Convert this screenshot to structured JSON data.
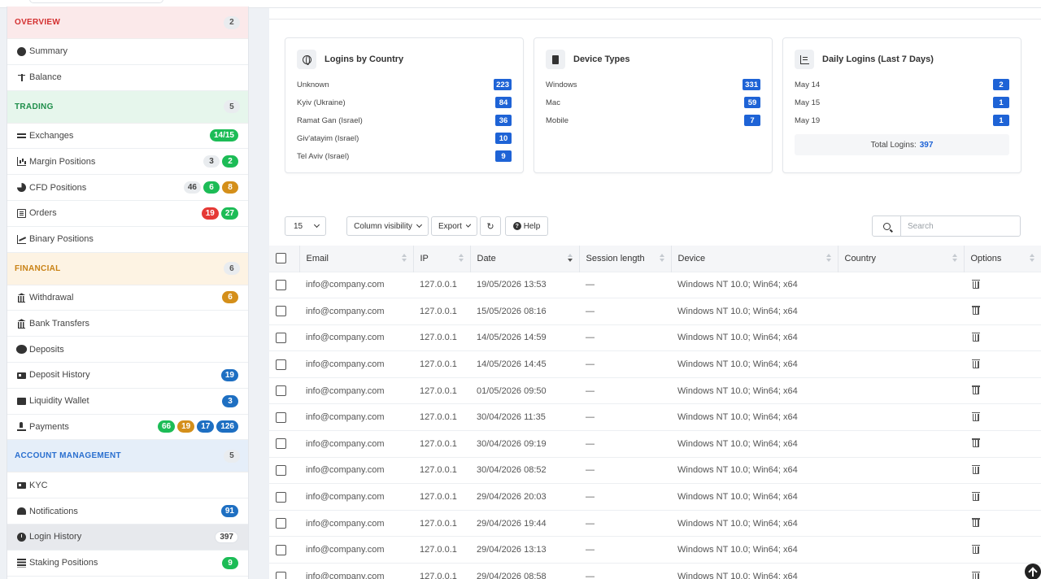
{
  "sidebar": {
    "sections": [
      {
        "key": "overview",
        "label": "OVERVIEW",
        "count": "2",
        "items": [
          {
            "key": "summary",
            "label": "Summary",
            "icon": "user-circle-icon",
            "badges": []
          },
          {
            "key": "balance",
            "label": "Balance",
            "icon": "scale-icon",
            "badges": []
          }
        ]
      },
      {
        "key": "trading",
        "label": "TRADING",
        "count": "5",
        "items": [
          {
            "key": "exchanges",
            "label": "Exchanges",
            "icon": "exchange-arrows-icon",
            "badges": [
              {
                "text": "14/15",
                "color": "green"
              }
            ]
          },
          {
            "key": "margin-positions",
            "label": "Margin Positions",
            "icon": "bar-chart-icon",
            "badges": [
              {
                "text": "3",
                "color": "grey"
              },
              {
                "text": "2",
                "color": "green"
              }
            ]
          },
          {
            "key": "cfd-positions",
            "label": "CFD Positions",
            "icon": "pie-chart-icon",
            "badges": [
              {
                "text": "46",
                "color": "grey"
              },
              {
                "text": "6",
                "color": "green"
              },
              {
                "text": "8",
                "color": "orange"
              }
            ]
          },
          {
            "key": "orders",
            "label": "Orders",
            "icon": "list-icon",
            "badges": [
              {
                "text": "19",
                "color": "red"
              },
              {
                "text": "27",
                "color": "green"
              }
            ]
          },
          {
            "key": "binary-positions",
            "label": "Binary Positions",
            "icon": "line-chart-icon",
            "badges": []
          }
        ]
      },
      {
        "key": "financial",
        "label": "FINANCIAL",
        "count": "6",
        "items": [
          {
            "key": "withdrawal",
            "label": "Withdrawal",
            "icon": "bank-icon",
            "badges": [
              {
                "text": "6",
                "color": "orange"
              }
            ]
          },
          {
            "key": "bank-transfers",
            "label": "Bank Transfers",
            "icon": "bank-icon",
            "badges": []
          },
          {
            "key": "deposits",
            "label": "Deposits",
            "icon": "piggy-bank-icon",
            "badges": []
          },
          {
            "key": "deposit-history",
            "label": "Deposit History",
            "icon": "credit-card-icon",
            "badges": [
              {
                "text": "19",
                "color": "blue"
              }
            ]
          },
          {
            "key": "liquidity-wallet",
            "label": "Liquidity Wallet",
            "icon": "wallet-icon",
            "badges": [
              {
                "text": "3",
                "color": "blue"
              }
            ]
          },
          {
            "key": "payments",
            "label": "Payments",
            "icon": "hand-coin-icon",
            "badges": [
              {
                "text": "66",
                "color": "green"
              },
              {
                "text": "19",
                "color": "orange"
              },
              {
                "text": "17",
                "color": "blue"
              },
              {
                "text": "126",
                "color": "blue"
              }
            ]
          }
        ]
      },
      {
        "key": "account",
        "label": "ACCOUNT MANAGEMENT",
        "count": "5",
        "items": [
          {
            "key": "kyc",
            "label": "KYC",
            "icon": "id-card-icon",
            "badges": []
          },
          {
            "key": "notifications",
            "label": "Notifications",
            "icon": "bell-icon",
            "badges": [
              {
                "text": "91",
                "color": "blue"
              }
            ]
          },
          {
            "key": "login-history",
            "label": "Login History",
            "icon": "clock-icon",
            "active": true,
            "badges": [
              {
                "text": "397",
                "color": "white"
              }
            ]
          },
          {
            "key": "staking-positions",
            "label": "Staking Positions",
            "icon": "layers-icon",
            "badges": [
              {
                "text": "9",
                "color": "green"
              }
            ]
          }
        ]
      }
    ]
  },
  "cards": {
    "country": {
      "title": "Logins by Country",
      "icon": "globe-icon",
      "rows": [
        {
          "label": "Unknown",
          "value": "223"
        },
        {
          "label": "Kyiv (Ukraine)",
          "value": "84"
        },
        {
          "label": "Ramat Gan (Israel)",
          "value": "36"
        },
        {
          "label": "Giv'atayim (Israel)",
          "value": "10"
        },
        {
          "label": "Tel Aviv (Israel)",
          "value": "9"
        }
      ]
    },
    "device": {
      "title": "Device Types",
      "icon": "mobile-icon",
      "rows": [
        {
          "label": "Windows",
          "value": "331"
        },
        {
          "label": "Mac",
          "value": "59"
        },
        {
          "label": "Mobile",
          "value": "7"
        }
      ]
    },
    "daily": {
      "title": "Daily Logins (Last 7 Days)",
      "icon": "bar-chart-icon",
      "rows": [
        {
          "label": "May 14",
          "value": "2"
        },
        {
          "label": "May 15",
          "value": "1"
        },
        {
          "label": "May 19",
          "value": "1"
        }
      ],
      "total_label": "Total Logins:",
      "total_value": "397"
    }
  },
  "toolbar": {
    "page_size": "15",
    "column_visibility": "Column visibility",
    "export": "Export",
    "help": "Help",
    "search_placeholder": "Search"
  },
  "table": {
    "columns": [
      "Email",
      "IP",
      "Date",
      "Session length",
      "Device",
      "Country",
      "Options"
    ],
    "rows": [
      {
        "email": "info@company.com",
        "ip": "127.0.0.1",
        "date": "19/05/2026 13:53",
        "session": "—",
        "device": "Windows NT 10.0; Win64; x64",
        "country": ""
      },
      {
        "email": "info@company.com",
        "ip": "127.0.0.1",
        "date": "15/05/2026 08:16",
        "session": "—",
        "device": "Windows NT 10.0; Win64; x64",
        "country": ""
      },
      {
        "email": "info@company.com",
        "ip": "127.0.0.1",
        "date": "14/05/2026 14:59",
        "session": "—",
        "device": "Windows NT 10.0; Win64; x64",
        "country": ""
      },
      {
        "email": "info@company.com",
        "ip": "127.0.0.1",
        "date": "14/05/2026 14:45",
        "session": "—",
        "device": "Windows NT 10.0; Win64; x64",
        "country": ""
      },
      {
        "email": "info@company.com",
        "ip": "127.0.0.1",
        "date": "01/05/2026 09:50",
        "session": "—",
        "device": "Windows NT 10.0; Win64; x64",
        "country": ""
      },
      {
        "email": "info@company.com",
        "ip": "127.0.0.1",
        "date": "30/04/2026 11:35",
        "session": "—",
        "device": "Windows NT 10.0; Win64; x64",
        "country": ""
      },
      {
        "email": "info@company.com",
        "ip": "127.0.0.1",
        "date": "30/04/2026 09:19",
        "session": "—",
        "device": "Windows NT 10.0; Win64; x64",
        "country": ""
      },
      {
        "email": "info@company.com",
        "ip": "127.0.0.1",
        "date": "30/04/2026 08:52",
        "session": "—",
        "device": "Windows NT 10.0; Win64; x64",
        "country": ""
      },
      {
        "email": "info@company.com",
        "ip": "127.0.0.1",
        "date": "29/04/2026 20:03",
        "session": "—",
        "device": "Windows NT 10.0; Win64; x64",
        "country": ""
      },
      {
        "email": "info@company.com",
        "ip": "127.0.0.1",
        "date": "29/04/2026 19:44",
        "session": "—",
        "device": "Windows NT 10.0; Win64; x64",
        "country": ""
      },
      {
        "email": "info@company.com",
        "ip": "127.0.0.1",
        "date": "29/04/2026 13:13",
        "session": "—",
        "device": "Windows NT 10.0; Win64; x64",
        "country": ""
      },
      {
        "email": "info@company.com",
        "ip": "127.0.0.1",
        "date": "29/04/2026 08:58",
        "session": "—",
        "device": "Windows NT 10.0; Win64; x64",
        "country": ""
      }
    ]
  },
  "colors": {
    "accent_blue": "#1e63d6",
    "badge_green": "#1cbc56",
    "badge_red": "#e53935",
    "badge_orange": "#d48f1a",
    "badge_blue": "#1e6fc2"
  }
}
